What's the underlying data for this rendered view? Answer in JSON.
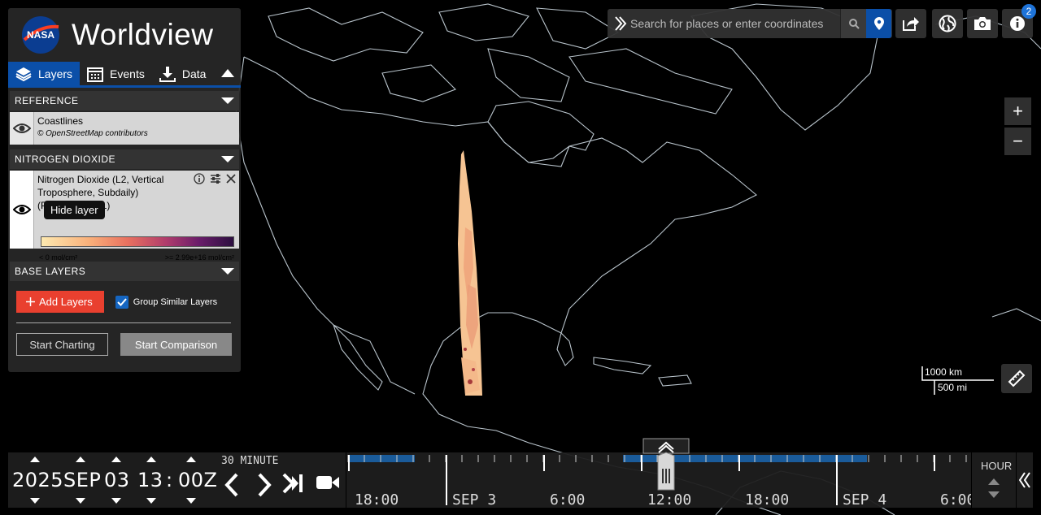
{
  "app": {
    "title": "Worldview",
    "logo_text": "NASA"
  },
  "tabs": [
    {
      "label": "Layers",
      "icon": "layers-icon",
      "active": true
    },
    {
      "label": "Events",
      "icon": "calendar-icon",
      "active": false
    },
    {
      "label": "Data",
      "icon": "download-icon",
      "active": false
    }
  ],
  "groups": {
    "reference": {
      "title": "REFERENCE",
      "layer": {
        "title": "Coastlines",
        "attribution": "© OpenStreetMap contributors"
      }
    },
    "nitrogen": {
      "title": "NITROGEN DIOXIDE",
      "layer": {
        "title": "Nitrogen Dioxide (L2, Vertical Troposphere, Subdaily) (PROVISIONAL)",
        "tooltip": "Hide layer",
        "legend_min": "< 0 mol/cm²",
        "legend_max": ">= 2.99e+16 mol/cm²"
      }
    },
    "base": {
      "title": "BASE LAYERS"
    }
  },
  "actions": {
    "add_layers": "Add Layers",
    "group_similar": "Group Similar Layers",
    "group_similar_checked": true,
    "start_charting": "Start Charting",
    "start_comparison": "Start Comparison"
  },
  "search": {
    "placeholder": "Search for places or enter coordinates"
  },
  "toolbar": {
    "info_badge": "2"
  },
  "zoom": {
    "in": "+",
    "out": "−"
  },
  "scale": {
    "km": "1000 km",
    "mi": "500 mi"
  },
  "date": {
    "year": "2025",
    "month": "SEP",
    "day": "03",
    "hour": "13",
    "sep": ":",
    "minute": "00Z",
    "interval": "30 MINUTE"
  },
  "timeline": {
    "labels": [
      "18:00",
      "SEP 3",
      "6:00",
      "12:00",
      "18:00",
      "SEP 4",
      "6:00"
    ],
    "zoom_level": "HOUR"
  },
  "colors": {
    "accent": "#0b4fa8",
    "add": "#e9402f",
    "coast": "#b9c4cc"
  }
}
